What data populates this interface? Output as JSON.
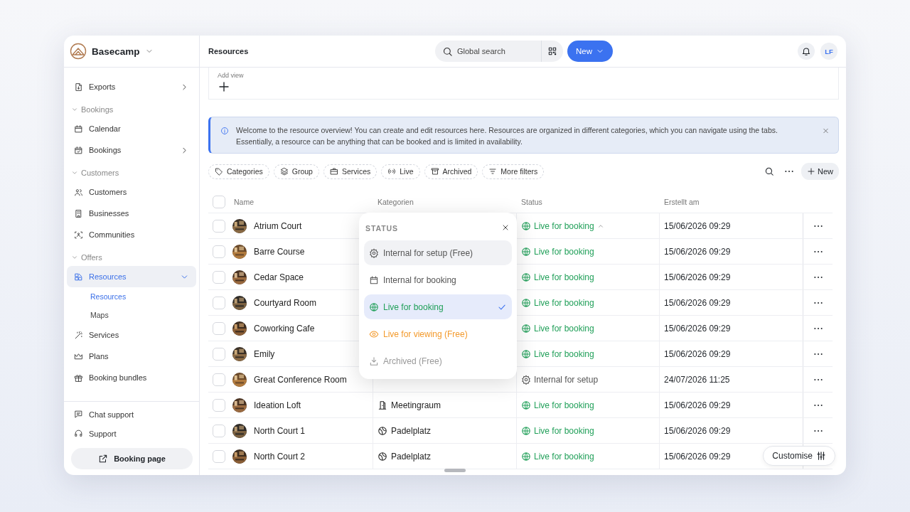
{
  "app": {
    "name": "Basecamp"
  },
  "sidebar": {
    "top": [
      {
        "label": "Exports",
        "has_submenu": true,
        "selected": false
      }
    ],
    "groups": [
      {
        "title": "Bookings",
        "expanded": true,
        "items": [
          {
            "label": "Calendar",
            "has_submenu": false,
            "selected": false
          },
          {
            "label": "Bookings",
            "has_submenu": true,
            "selected": false
          }
        ]
      },
      {
        "title": "Customers",
        "expanded": true,
        "items": [
          {
            "label": "Customers",
            "has_submenu": false,
            "selected": false
          },
          {
            "label": "Businesses",
            "has_submenu": false,
            "selected": false
          },
          {
            "label": "Communities",
            "has_submenu": false,
            "selected": false
          }
        ]
      },
      {
        "title": "Offers",
        "expanded": true,
        "items": [
          {
            "label": "Resources",
            "has_submenu": false,
            "selected": true,
            "expanded": true,
            "children": [
              {
                "label": "Resources",
                "selected": true
              },
              {
                "label": "Maps",
                "selected": false
              }
            ]
          },
          {
            "label": "Services",
            "has_submenu": false,
            "selected": false
          },
          {
            "label": "Plans",
            "has_submenu": false,
            "selected": false
          },
          {
            "label": "Booking bundles",
            "has_submenu": false,
            "selected": false
          }
        ]
      }
    ],
    "footer": [
      {
        "label": "Chat support"
      },
      {
        "label": "Support"
      }
    ],
    "booking_page_button": "Booking page"
  },
  "topbar": {
    "title": "Resources",
    "search": {
      "placeholder": "Global search"
    },
    "new_button": "New",
    "avatar": "LF"
  },
  "views": {
    "add_view_label": "Add view"
  },
  "banner": {
    "text": "Welcome to the resource overview! You can create and edit resources here. Resources are organized in different categories, which you can navigate using the tabs. Essentially, a resource can be anything that can be booked and is limited in availability."
  },
  "filters": [
    {
      "label": "Categories"
    },
    {
      "label": "Group"
    },
    {
      "label": "Services"
    },
    {
      "label": "Live"
    },
    {
      "label": "Archived"
    },
    {
      "label": "More filters"
    }
  ],
  "toolbar": {
    "new_button": "New"
  },
  "table": {
    "all_checked": false,
    "columns": [
      "Name",
      "Kategorien",
      "Status",
      "Erstellt am"
    ],
    "rows": [
      {
        "name": "Atrium Court",
        "checked": false,
        "status": {
          "label": "Live for booking",
          "kind": "live"
        },
        "menu_open": true,
        "created": "15/06/2026 09:29"
      },
      {
        "name": "Barre Course",
        "checked": false,
        "status": {
          "label": "Live for booking",
          "kind": "live"
        },
        "menu_open": false,
        "created": "15/06/2026 09:29"
      },
      {
        "name": "Cedar Space",
        "checked": false,
        "status": {
          "label": "Live for booking",
          "kind": "live"
        },
        "menu_open": false,
        "created": "15/06/2026 09:29"
      },
      {
        "name": "Courtyard Room",
        "checked": false,
        "status": {
          "label": "Live for booking",
          "kind": "live"
        },
        "menu_open": false,
        "created": "15/06/2026 09:29"
      },
      {
        "name": "Coworking Cafe",
        "checked": false,
        "status": {
          "label": "Live for booking",
          "kind": "live"
        },
        "menu_open": false,
        "created": "15/06/2026 09:29"
      },
      {
        "name": "Emily",
        "checked": false,
        "status": {
          "label": "Live for booking",
          "kind": "live"
        },
        "menu_open": false,
        "created": "15/06/2026 09:29"
      },
      {
        "name": "Great Conference Room",
        "checked": false,
        "status": {
          "label": "Internal for setup",
          "kind": "setup"
        },
        "menu_open": false,
        "created": "24/07/2026 11:25"
      },
      {
        "name": "Ideation Loft",
        "checked": false,
        "category": {
          "label": "Meetingraum",
          "kind": "room"
        },
        "status": {
          "label": "Live for booking",
          "kind": "live"
        },
        "menu_open": false,
        "created": "15/06/2026 09:29"
      },
      {
        "name": "North Court 1",
        "checked": false,
        "category": {
          "label": "Padelplatz",
          "kind": "court"
        },
        "status": {
          "label": "Live for booking",
          "kind": "live"
        },
        "menu_open": false,
        "created": "15/06/2026 09:29"
      },
      {
        "name": "North Court 2",
        "checked": false,
        "category": {
          "label": "Padelplatz",
          "kind": "court"
        },
        "status": {
          "label": "Live for booking",
          "kind": "live"
        },
        "menu_open": false,
        "created": "15/06/2026 09:29"
      }
    ]
  },
  "status_menu": {
    "title": "STATUS",
    "options": [
      {
        "label": "Internal for setup (Free)",
        "kind": "setup",
        "selected": false,
        "hovered": true
      },
      {
        "label": "Internal for booking",
        "kind": "internal",
        "selected": false,
        "hovered": false
      },
      {
        "label": "Live for booking",
        "kind": "live",
        "selected": true,
        "hovered": false
      },
      {
        "label": "Live for viewing (Free)",
        "kind": "viewing",
        "selected": false,
        "hovered": false
      },
      {
        "label": "Archived (Free)",
        "kind": "archived",
        "selected": false,
        "hovered": false
      }
    ]
  },
  "customise_button": "Customise"
}
